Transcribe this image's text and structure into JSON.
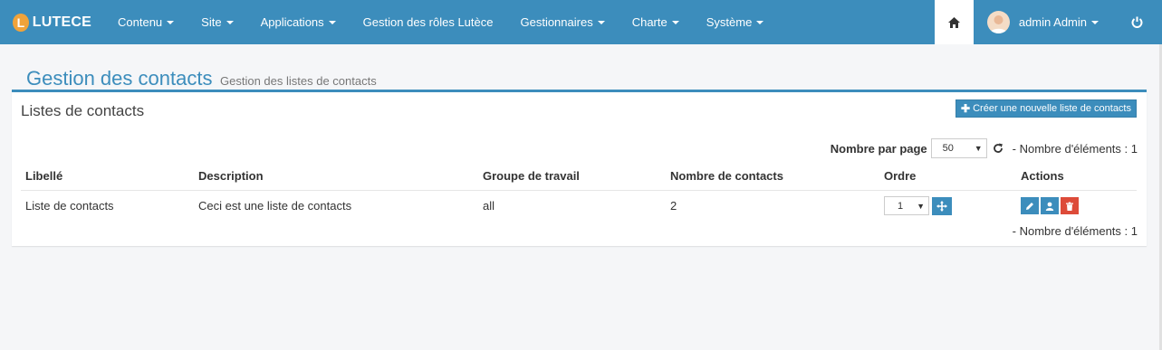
{
  "navbar": {
    "brand_letter": "L",
    "brand": "LUTECE",
    "items": [
      {
        "label": "Contenu",
        "dropdown": true
      },
      {
        "label": "Site",
        "dropdown": true
      },
      {
        "label": "Applications",
        "dropdown": true
      },
      {
        "label": "Gestion des rôles Lutèce",
        "dropdown": false
      },
      {
        "label": "Gestionnaires",
        "dropdown": true
      },
      {
        "label": "Charte",
        "dropdown": true
      },
      {
        "label": "Système",
        "dropdown": true
      }
    ],
    "user": "admin Admin",
    "icons": {
      "home": "home-icon",
      "power": "power-icon",
      "avatar": "user-avatar"
    },
    "color": "#3c8dbc"
  },
  "header": {
    "title": "Gestion des contacts",
    "subtitle": "Gestion des listes de contacts"
  },
  "box": {
    "title": "Listes de contacts",
    "create_button": "Créer une nouvelle liste de contacts",
    "pager": {
      "label": "Nombre par page",
      "value": "50",
      "count": "- Nombre d'éléments : 1"
    },
    "columns": [
      "Libellé",
      "Description",
      "Groupe de travail",
      "Nombre de contacts",
      "Ordre",
      "Actions"
    ],
    "rows": [
      {
        "libelle": "Liste de contacts",
        "description": "Ceci est une liste de contacts",
        "groupe": "all",
        "nombre": "2",
        "ordre": "1"
      }
    ],
    "count_bottom": "- Nombre d'éléments : 1"
  },
  "colors": {
    "primary": "#3c8dbc",
    "danger": "#dd4b39",
    "logo": "#f0a33a"
  }
}
